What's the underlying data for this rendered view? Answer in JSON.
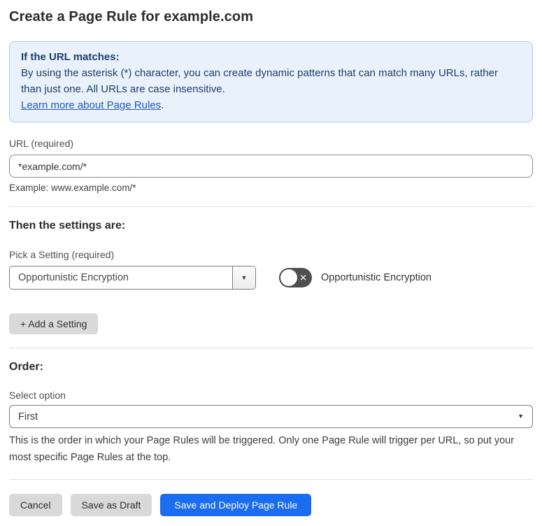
{
  "page": {
    "title": "Create a Page Rule for example.com"
  },
  "info_box": {
    "heading": "If the URL matches:",
    "body": "By using the asterisk (*) character, you can create dynamic patterns that can match many URLs, rather than just one. All URLs are case insensitive.",
    "link_label": "Learn more about Page Rules",
    "link_suffix": "."
  },
  "url_section": {
    "label": "URL (required)",
    "value": "*example.com/*",
    "example": "Example: www.example.com/*"
  },
  "settings_section": {
    "heading": "Then the settings are:",
    "picker_label": "Pick a Setting (required)",
    "selected_setting": "Opportunistic Encryption",
    "toggle_label": "Opportunistic Encryption",
    "toggle_state": "off",
    "add_setting_label": "+ Add a Setting"
  },
  "order_section": {
    "heading": "Order:",
    "select_label": "Select option",
    "selected_option": "First",
    "help": "This is the order in which your Page Rules will be triggered. Only one Page Rule will trigger per URL, so put your most specific Page Rules at the top."
  },
  "footer": {
    "cancel_label": "Cancel",
    "save_draft_label": "Save as Draft",
    "save_deploy_label": "Save and Deploy Page Rule"
  },
  "colors": {
    "primary_blue": "#1a6cf0",
    "info_bg": "#e9f2fc",
    "info_border": "#a9c9ee",
    "info_text": "#1d3d6d",
    "link_blue": "#2057c7",
    "toggle_off_bg": "#4f4f4f",
    "gray_button_bg": "#d9d9d9"
  },
  "icons": {
    "dropdown_caret": "▼",
    "toggle_x": "✕"
  }
}
